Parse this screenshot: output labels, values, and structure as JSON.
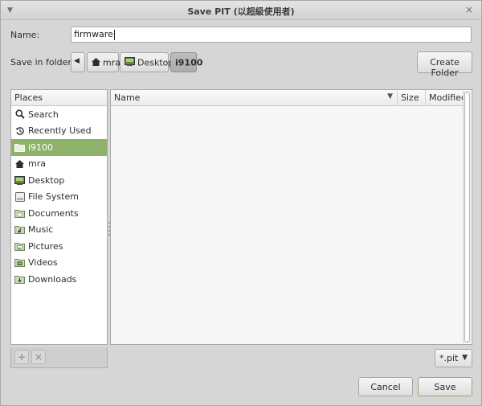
{
  "window": {
    "title": "Save PIT (以超級使用者)"
  },
  "name_row": {
    "label": "Name:",
    "value": "firmware"
  },
  "folder_row": {
    "label": "Save in folder:",
    "path": [
      {
        "label": "mra",
        "icon": "home-icon"
      },
      {
        "label": "Desktop",
        "icon": "desktop-icon"
      },
      {
        "label": "i9100",
        "icon": "",
        "active": true
      }
    ],
    "create_folder_label": "Create Folder"
  },
  "places": {
    "header": "Places",
    "items": [
      {
        "label": "Search",
        "icon": "search-icon"
      },
      {
        "label": "Recently Used",
        "icon": "recent-icon"
      },
      {
        "label": "i9100",
        "icon": "folder-icon",
        "selected": true
      },
      {
        "label": "mra",
        "icon": "home-icon"
      },
      {
        "label": "Desktop",
        "icon": "desktop-icon"
      },
      {
        "label": "File System",
        "icon": "drive-icon"
      },
      {
        "label": "Documents",
        "icon": "documents-folder-icon"
      },
      {
        "label": "Music",
        "icon": "music-folder-icon"
      },
      {
        "label": "Pictures",
        "icon": "pictures-folder-icon"
      },
      {
        "label": "Videos",
        "icon": "videos-folder-icon"
      },
      {
        "label": "Downloads",
        "icon": "downloads-folder-icon"
      }
    ]
  },
  "files": {
    "columns": {
      "name": "Name",
      "size": "Size",
      "modified": "Modified"
    },
    "rows": []
  },
  "filter": {
    "value": "*.pit"
  },
  "actions": {
    "cancel_label": "Cancel",
    "save_label": "Save"
  },
  "colors": {
    "selection": "#8eb26a",
    "window_bg": "#d6d6d6"
  }
}
